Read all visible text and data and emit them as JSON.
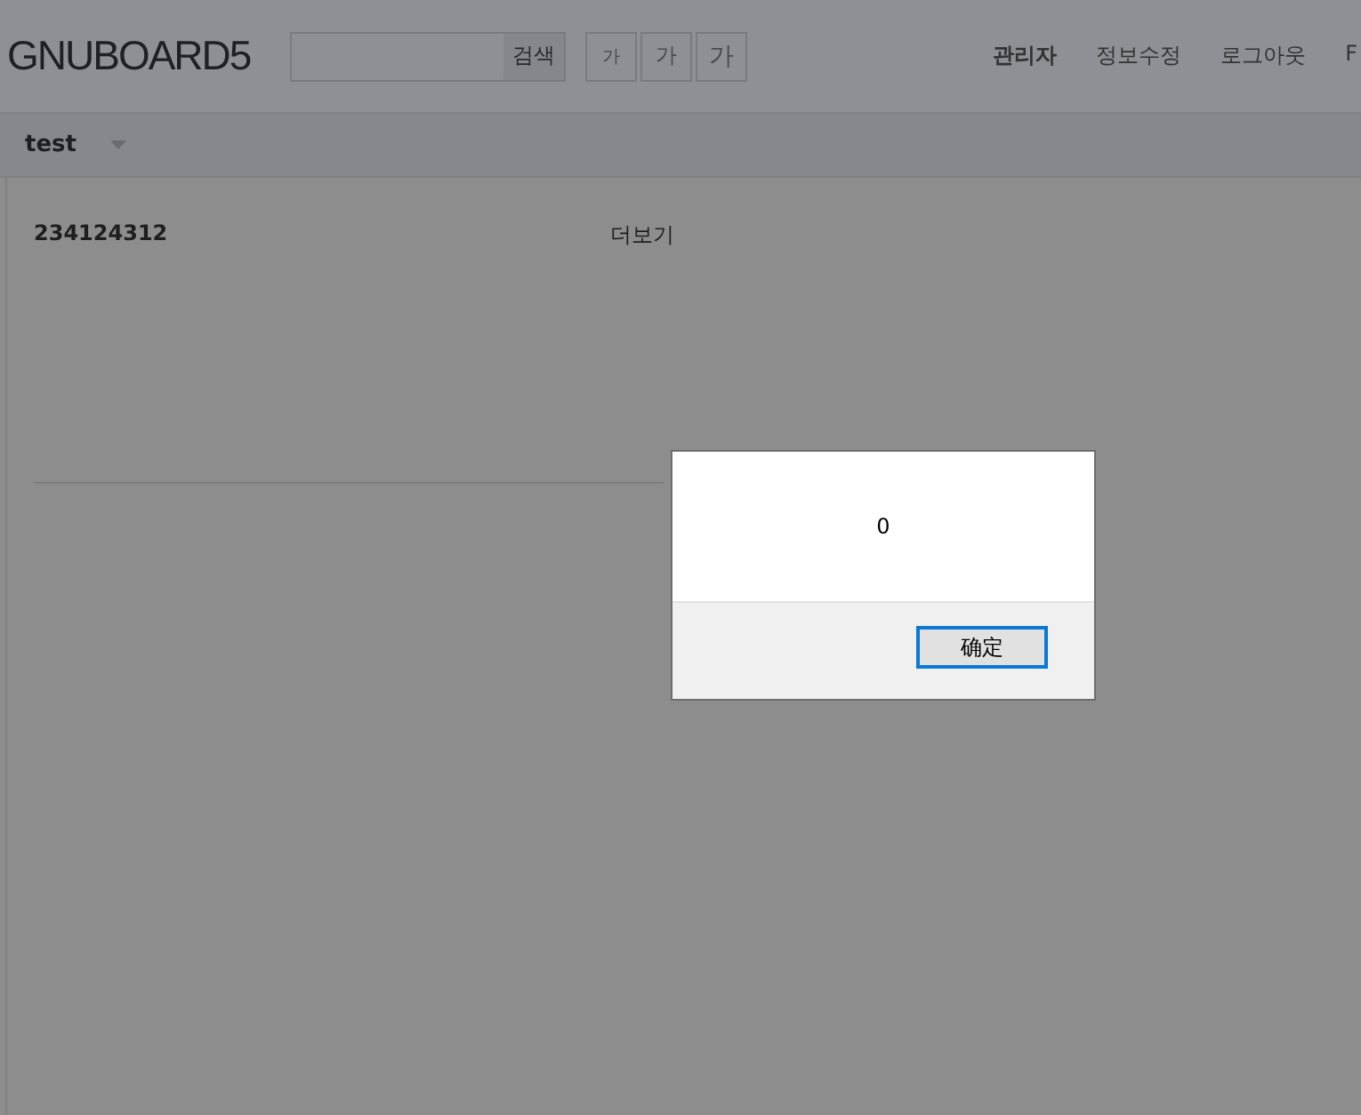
{
  "header": {
    "logo": "GNUBOARD5",
    "search": {
      "button": "검색"
    },
    "font_sizes": [
      "가",
      "가",
      "가"
    ],
    "nav": [
      {
        "label": "관리자",
        "bold": true
      },
      {
        "label": "정보수정",
        "bold": false
      },
      {
        "label": "로그아웃",
        "bold": false
      },
      {
        "label": "F",
        "bold": false
      }
    ]
  },
  "menu": {
    "label": "test"
  },
  "post": {
    "title": "234124312",
    "more": "더보기"
  },
  "dialog": {
    "message": "0",
    "button": "确定"
  }
}
